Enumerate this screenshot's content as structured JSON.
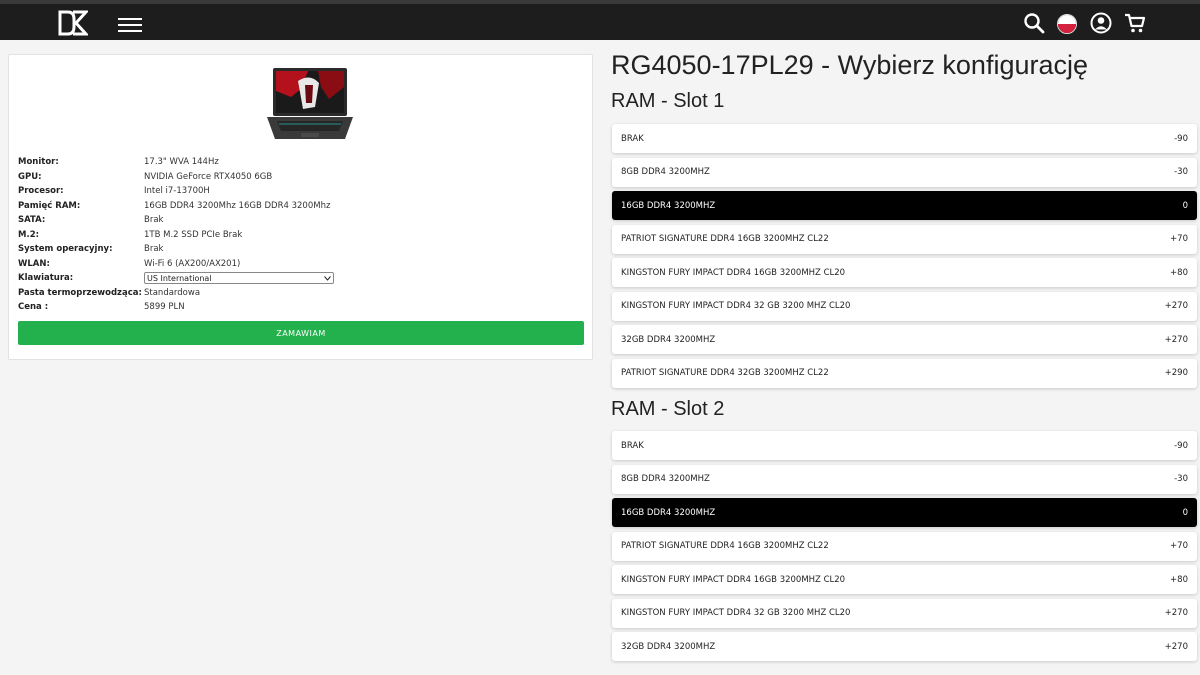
{
  "header": {
    "logo_icon": "dx-logo-icon",
    "menu_icon": "hamburger-icon",
    "icons": [
      "search-icon",
      "polish-flag-icon",
      "user-icon",
      "cart-icon"
    ]
  },
  "product": {
    "specs": [
      {
        "label": "Monitor:",
        "value": "17.3\" WVA 144Hz"
      },
      {
        "label": "GPU:",
        "value": "NVIDIA GeForce RTX4050 6GB"
      },
      {
        "label": "Procesor:",
        "value": "Intel i7-13700H"
      },
      {
        "label": "Pamięć RAM:",
        "value": "16GB DDR4 3200Mhz 16GB DDR4 3200Mhz"
      },
      {
        "label": "SATA:",
        "value": "Brak"
      },
      {
        "label": "M.2:",
        "value": "1TB M.2 SSD PCIe Brak"
      },
      {
        "label": "System operacyjny:",
        "value": "Brak"
      },
      {
        "label": "WLAN:",
        "value": "Wi-Fi 6 (AX200/AX201)"
      },
      {
        "label": "Klawiatura:",
        "value": "US International"
      },
      {
        "label": "Pasta termoprzewodząca:",
        "value": "Standardowa"
      },
      {
        "label": "Cena :",
        "value": "5899 PLN"
      }
    ],
    "order_button": "ZAMAWIAM"
  },
  "config": {
    "title": "RG4050-17PL29 - Wybierz konfigurację",
    "slot1": {
      "title": "RAM - Slot 1",
      "options": [
        {
          "name": "BRAK",
          "price": "-90",
          "selected": false
        },
        {
          "name": "8GB DDR4 3200MHZ",
          "price": "-30",
          "selected": false
        },
        {
          "name": "16GB DDR4 3200MHZ",
          "price": "0",
          "selected": true
        },
        {
          "name": "PATRIOT SIGNATURE DDR4 16GB 3200MHZ CL22",
          "price": "+70",
          "selected": false
        },
        {
          "name": "KINGSTON FURY IMPACT DDR4 16GB 3200MHZ CL20",
          "price": "+80",
          "selected": false
        },
        {
          "name": "KINGSTON FURY IMPACT DDR4 32 GB 3200 MHZ CL20",
          "price": "+270",
          "selected": false
        },
        {
          "name": "32GB DDR4 3200MHZ",
          "price": "+270",
          "selected": false
        },
        {
          "name": "PATRIOT SIGNATURE DDR4 32GB 3200MHZ CL22",
          "price": "+290",
          "selected": false
        }
      ]
    },
    "slot2": {
      "title": "RAM - Slot 2",
      "options": [
        {
          "name": "BRAK",
          "price": "-90",
          "selected": false
        },
        {
          "name": "8GB DDR4 3200MHZ",
          "price": "-30",
          "selected": false
        },
        {
          "name": "16GB DDR4 3200MHZ",
          "price": "0",
          "selected": true
        },
        {
          "name": "PATRIOT SIGNATURE DDR4 16GB 3200MHZ CL22",
          "price": "+70",
          "selected": false
        },
        {
          "name": "KINGSTON FURY IMPACT DDR4 16GB 3200MHZ CL20",
          "price": "+80",
          "selected": false
        },
        {
          "name": "KINGSTON FURY IMPACT DDR4 32 GB 3200 MHZ CL20",
          "price": "+270",
          "selected": false
        },
        {
          "name": "32GB DDR4 3200MHZ",
          "price": "+270",
          "selected": false
        }
      ]
    }
  },
  "colors": {
    "topbar": "#1d1d1d",
    "order_button": "#22b14c",
    "selected_option": "#000000"
  }
}
